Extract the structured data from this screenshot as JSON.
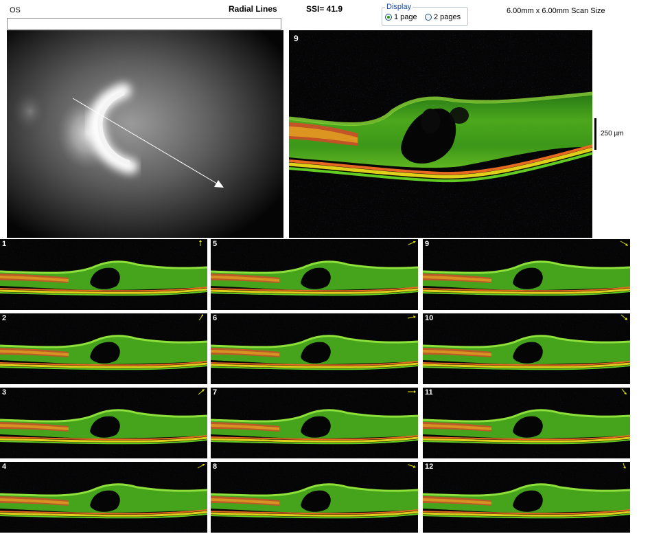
{
  "header": {
    "eye": "OS",
    "scan_type": "Radial Lines",
    "ssi": "SSI= 41.9",
    "scan_size": "6.00mm x 6.00mm Scan Size"
  },
  "display": {
    "legend": "Display",
    "options": [
      {
        "label": "1 page",
        "selected": true
      },
      {
        "label": "2 pages",
        "selected": false
      }
    ]
  },
  "main_scan": {
    "number": "9",
    "scale_label": "250 µm"
  },
  "thumbnails": [
    {
      "number": "1"
    },
    {
      "number": "5"
    },
    {
      "number": "9"
    },
    {
      "number": "2"
    },
    {
      "number": "6"
    },
    {
      "number": "10"
    },
    {
      "number": "3"
    },
    {
      "number": "7"
    },
    {
      "number": "11"
    },
    {
      "number": "4"
    },
    {
      "number": "8"
    },
    {
      "number": "12"
    }
  ],
  "colors": {
    "scan_background": "#050505",
    "retina_green": "#46c21c",
    "retina_yellow": "#d8d21a",
    "retina_orange": "#e4551c",
    "arrow": "#e4e400"
  }
}
